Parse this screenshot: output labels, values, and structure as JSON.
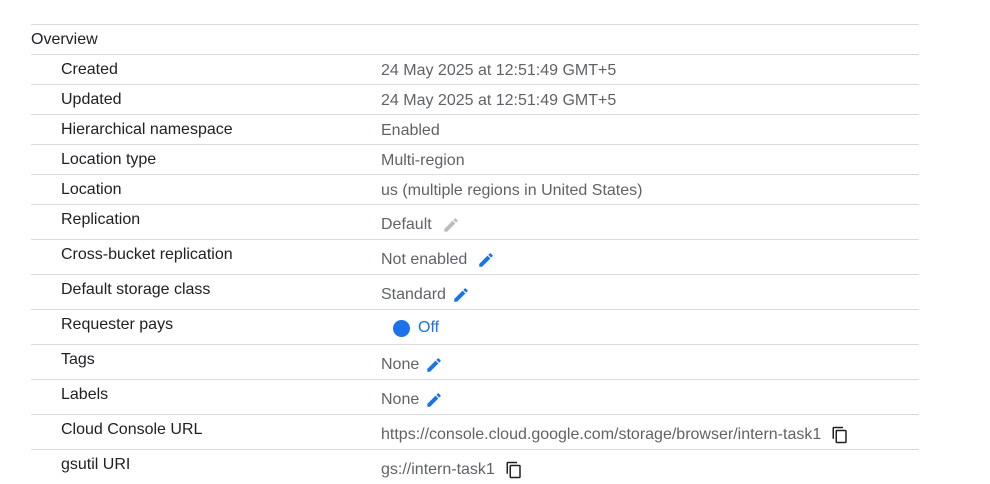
{
  "overview": {
    "title": "Overview",
    "rows": [
      {
        "key": "Created",
        "value": "24 May 2025 at 12:51:49 GMT+5"
      },
      {
        "key": "Updated",
        "value": "24 May 2025 at 12:51:49 GMT+5"
      },
      {
        "key": "Hierarchical namespace",
        "value": "Enabled"
      },
      {
        "key": "Location type",
        "value": "Multi-region"
      },
      {
        "key": "Location",
        "value": "us (multiple regions in United States)"
      },
      {
        "key": "Replication",
        "value": "Default",
        "icon": "edit-icon-disabled"
      },
      {
        "key": "Cross-bucket replication",
        "value": "Not enabled",
        "icon": "edit-icon"
      },
      {
        "key": "Default storage class",
        "value": "Standard",
        "icon": "edit-icon"
      },
      {
        "key": "Requester pays",
        "value": "Off",
        "icon": "toggle-switch"
      },
      {
        "key": "Tags",
        "value": "None",
        "icon": "edit-icon"
      },
      {
        "key": "Labels",
        "value": "None",
        "icon": "edit-icon"
      },
      {
        "key": "Cloud Console URL",
        "value": "https://console.cloud.google.com/storage/browser/intern-task1",
        "icon": "copy-icon"
      },
      {
        "key": "gsutil URI",
        "value": "gs://intern-task1",
        "icon": "copy-icon"
      }
    ]
  },
  "colors": {
    "accent": "#1a73e8",
    "disabled_icon": "#bdbdbd",
    "value_text": "#5f6368",
    "divider": "#dadce0"
  }
}
